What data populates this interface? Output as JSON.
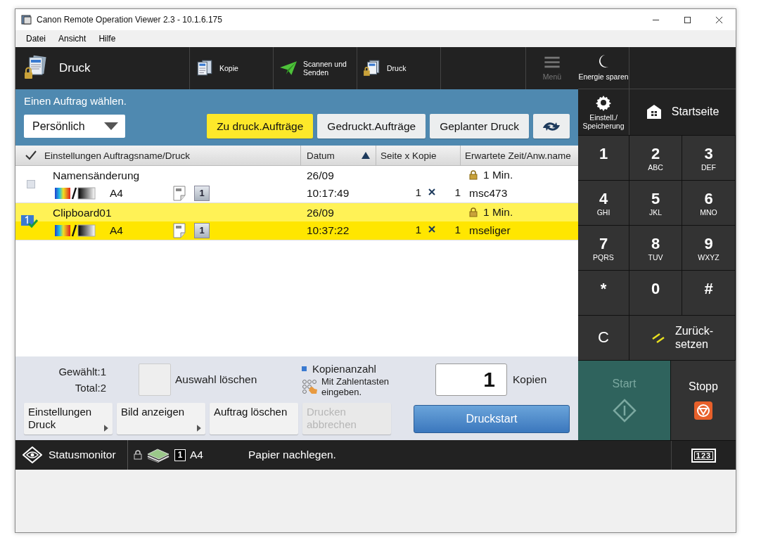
{
  "window": {
    "title": "Canon Remote Operation Viewer 2.3 - 10.1.6.175"
  },
  "menu": [
    "Datei",
    "Ansicht",
    "Hilfe"
  ],
  "header": {
    "title": "Druck",
    "shortcuts": [
      {
        "label": "Kopie",
        "kind": "copy"
      },
      {
        "label": "Scannen und Senden",
        "kind": "send"
      },
      {
        "label": "Druck",
        "kind": "print"
      }
    ],
    "menu_button": {
      "label": "Menü",
      "disabled": true
    },
    "energy_label": "Energie sparen"
  },
  "job_panel": {
    "instruction": "Einen Auftrag wählen.",
    "dropdown": "Persönlich",
    "filters": [
      {
        "label": "Zu druck.Aufträge",
        "selected": true
      },
      {
        "label": "Gedruckt.Aufträge",
        "selected": false
      },
      {
        "label": "Geplanter Druck",
        "selected": false
      }
    ]
  },
  "table": {
    "columns": [
      "Einstellungen Auftragsname/Druck",
      "Datum",
      "Seite x Kopie",
      "Erwartete Zeit/Anw.name"
    ],
    "rows": [
      {
        "name": "Namensänderung",
        "paper": "A4",
        "copies_badge": "1",
        "date": "26/09",
        "time": "10:17:49",
        "pages": "1",
        "copies": "1",
        "duration": "1 Min.",
        "user": "msc473",
        "selected": false
      },
      {
        "name": "Clipboard01",
        "paper": "A4",
        "copies_badge": "1",
        "date": "26/09",
        "time": "10:37:22",
        "pages": "1",
        "copies": "1",
        "duration": "1 Min.",
        "user": "mseliger",
        "selected": true
      }
    ]
  },
  "bottom": {
    "selected_count": "Gewählt:1",
    "total_count": "Total:2",
    "clear_label": "Auswahl löschen",
    "copies_heading": "Kopienanzahl",
    "copies_hint": "Mit Zahlentasten eingeben.",
    "copies_value": "1",
    "copies_unit": "Kopien",
    "actions": [
      {
        "label": "Einstellungen Druck",
        "has_arrow": true,
        "disabled": false
      },
      {
        "label": "Bild anzeigen",
        "has_arrow": true,
        "disabled": false
      },
      {
        "label": "Auftrag löschen",
        "has_arrow": false,
        "disabled": false
      },
      {
        "label": "Drucken abbrechen",
        "has_arrow": false,
        "disabled": true
      }
    ],
    "print_button": "Druckstart"
  },
  "status_bar": {
    "monitor": "Statusmonitor",
    "tray_badge": "1",
    "paper": "A4",
    "message": "Papier nachlegen."
  },
  "side": {
    "settings_lines": [
      "Einstell./",
      "Speicherung"
    ],
    "home_label": "Startseite",
    "keys": [
      {
        "main": "1"
      },
      {
        "main": "2",
        "sub": "ABC"
      },
      {
        "main": "3",
        "sub": "DEF"
      },
      {
        "main": "4",
        "sub": "GHI"
      },
      {
        "main": "5",
        "sub": "JKL"
      },
      {
        "main": "6",
        "sub": "MNO"
      },
      {
        "main": "7",
        "sub": "PQRS"
      },
      {
        "main": "8",
        "sub": "TUV"
      },
      {
        "main": "9",
        "sub": "WXYZ"
      },
      {
        "main": "*"
      },
      {
        "main": "0"
      },
      {
        "main": "#"
      }
    ],
    "clear_key": "C",
    "reset_lines": [
      "Zurück-",
      "setzen"
    ],
    "start": {
      "label": "Start",
      "disabled": true
    },
    "stop_label": "Stopp",
    "keypad_toggle": "123"
  }
}
